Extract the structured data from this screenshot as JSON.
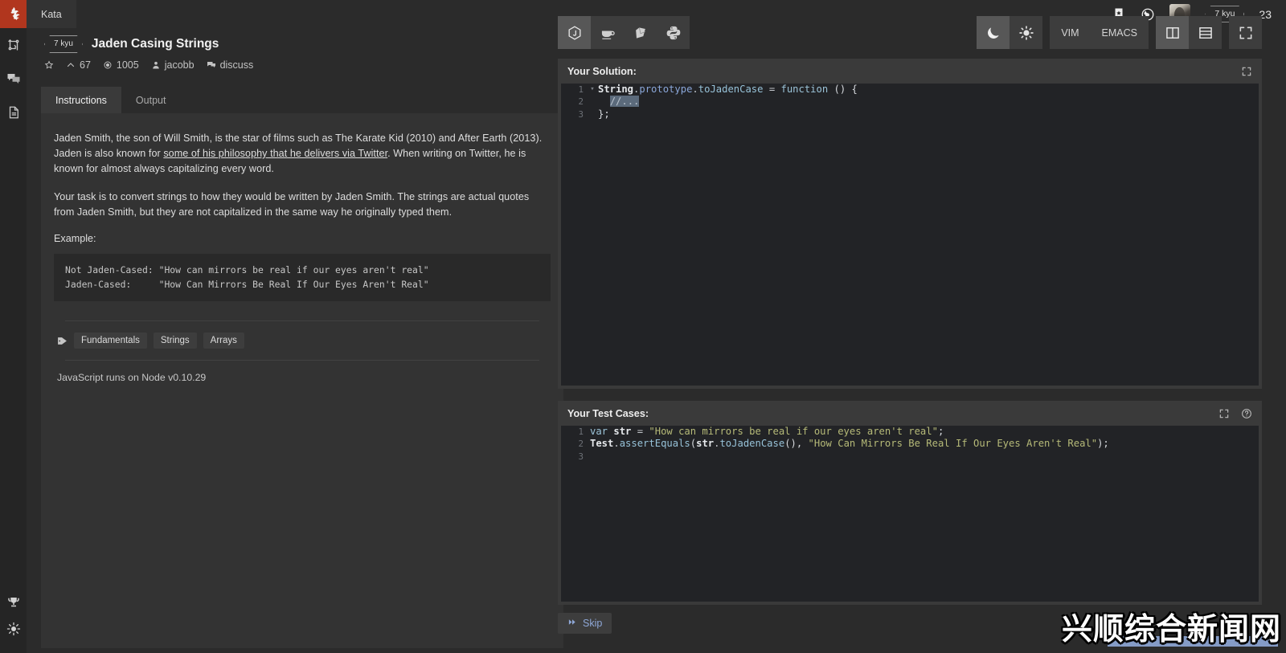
{
  "rail": {
    "logo_name": "codewars-logo",
    "items": [
      {
        "name": "kata-fork-icon",
        "label": "Kata"
      },
      {
        "name": "discussions-icon",
        "label": "Discussions"
      },
      {
        "name": "docs-icon",
        "label": "Docs"
      }
    ],
    "bottom_items": [
      {
        "name": "trophy-icon",
        "label": "Leaderboards"
      },
      {
        "name": "beta-icon",
        "label": "Beta"
      }
    ]
  },
  "topbar": {
    "tab_label": "Kata",
    "bookmark_icon": "bookmark-star-icon",
    "globe_icon": "globe-icon",
    "avatar": "user-avatar",
    "rank_badge": "7 kyu",
    "honor": "23"
  },
  "kata": {
    "rank": "7 kyu",
    "title": "Jaden Casing Strings",
    "meta": {
      "star_icon": "star-outline-icon",
      "upvotes_icon": "chevron-up-icon",
      "upvotes": "67",
      "satisfaction_icon": "target-icon",
      "completed": "1005",
      "author_icon": "user-icon",
      "author": "jacobb",
      "discuss_icon": "comment-icon",
      "discuss": "discuss"
    }
  },
  "left_panel": {
    "tabs": [
      {
        "label": "Instructions",
        "active": true
      },
      {
        "label": "Output",
        "active": false
      }
    ],
    "paragraph1_pre": "Jaden Smith, the son of Will Smith, is the star of films such as The Karate Kid (2010) and After Earth (2013). Jaden is also known for ",
    "paragraph1_link": "some of his philosophy that he delivers via Twitter",
    "paragraph1_post": ". When writing on Twitter, he is known for almost always capitalizing every word.",
    "paragraph2": "Your task is to convert strings to how they would be written by Jaden Smith. The strings are actual quotes from Jaden Smith, but they are not capitalized in the same way he originally typed them.",
    "example_label": "Example:",
    "example_code": "Not Jaden-Cased: \"How can mirrors be real if our eyes aren't real\"\nJaden-Cased:     \"How Can Mirrors Be Real If Our Eyes Aren't Real\"",
    "tags_icon": "tag-icon",
    "tags": [
      "Fundamentals",
      "Strings",
      "Arrays"
    ],
    "runtime_note": "JavaScript runs on Node v0.10.29"
  },
  "editor_toolbar": {
    "languages": [
      {
        "name": "nodejs-icon",
        "label": "JavaScript",
        "selected": true
      },
      {
        "name": "java-icon",
        "label": "Java",
        "selected": false
      },
      {
        "name": "ruby-icon",
        "label": "Ruby",
        "selected": false
      },
      {
        "name": "python-icon",
        "label": "Python",
        "selected": false
      }
    ],
    "theme_dark_icon": "moon-icon",
    "theme_light_icon": "sun-icon",
    "keymaps": [
      {
        "label": "VIM"
      },
      {
        "label": "EMACS"
      }
    ],
    "layout_vertical_icon": "split-vertical-icon",
    "layout_horizontal_icon": "split-horizontal-icon",
    "fullscreen_icon": "fullscreen-icon"
  },
  "solution": {
    "title": "Your Solution:",
    "expand_icon": "expand-icon",
    "lines": [
      {
        "num": "1",
        "fold": "▾",
        "tokens": [
          {
            "t": "String",
            "c": "tok-var"
          },
          {
            "t": ".",
            "c": "tok-op"
          },
          {
            "t": "prototype",
            "c": "tok-prop"
          },
          {
            "t": ".",
            "c": "tok-op"
          },
          {
            "t": "toJadenCase",
            "c": "tok-fn"
          },
          {
            "t": " = ",
            "c": "tok-op"
          },
          {
            "t": "function",
            "c": "tok-kw"
          },
          {
            "t": " () {",
            "c": "tok-plain"
          }
        ]
      },
      {
        "num": "2",
        "fold": "",
        "tokens": [
          {
            "t": "  ",
            "c": "tok-plain"
          },
          {
            "t": "//...",
            "c": "sel"
          }
        ]
      },
      {
        "num": "3",
        "fold": "",
        "tokens": [
          {
            "t": "};",
            "c": "tok-plain"
          }
        ]
      }
    ]
  },
  "test_cases": {
    "title": "Your Test Cases:",
    "expand_icon": "expand-icon",
    "help_icon": "help-circle-icon",
    "lines": [
      {
        "num": "1",
        "tokens": [
          {
            "t": "var",
            "c": "tok-kw"
          },
          {
            "t": " ",
            "c": "tok-plain"
          },
          {
            "t": "str",
            "c": "tok-var"
          },
          {
            "t": " = ",
            "c": "tok-op"
          },
          {
            "t": "\"How can mirrors be real if our eyes aren't real\"",
            "c": "tok-str"
          },
          {
            "t": ";",
            "c": "tok-plain"
          }
        ]
      },
      {
        "num": "2",
        "tokens": [
          {
            "t": "Test",
            "c": "tok-var"
          },
          {
            "t": ".",
            "c": "tok-op"
          },
          {
            "t": "assertEquals",
            "c": "tok-fn"
          },
          {
            "t": "(",
            "c": "tok-plain"
          },
          {
            "t": "str",
            "c": "tok-var"
          },
          {
            "t": ".",
            "c": "tok-op"
          },
          {
            "t": "toJadenCase",
            "c": "tok-fn"
          },
          {
            "t": "(), ",
            "c": "tok-plain"
          },
          {
            "t": "\"How Can Mirrors Be Real If Our Eyes Aren't Real\"",
            "c": "tok-str"
          },
          {
            "t": ");",
            "c": "tok-plain"
          }
        ]
      },
      {
        "num": "3",
        "tokens": []
      }
    ]
  },
  "footer": {
    "skip_icon": "fast-forward-icon",
    "skip_label": "Skip"
  },
  "watermark": {
    "text": "兴顺综合新闻网"
  }
}
